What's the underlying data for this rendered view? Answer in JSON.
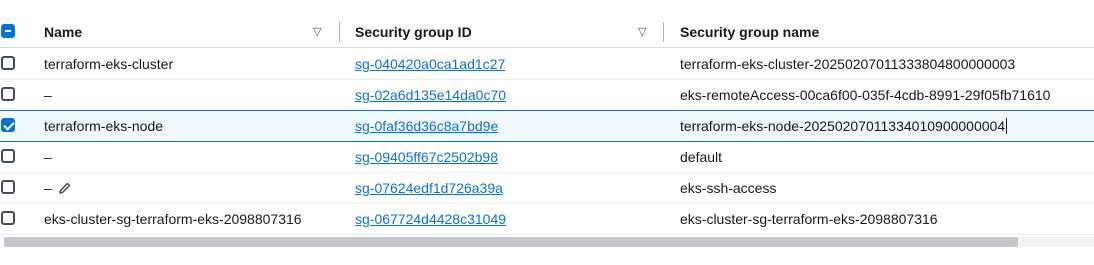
{
  "columns": {
    "name": "Name",
    "sg_id": "Security group ID",
    "sg_name": "Security group name",
    "sort_icon": "▽"
  },
  "rows": [
    {
      "name": "terraform-eks-cluster",
      "sg_id": "sg-040420a0ca1ad1c27",
      "sg_name": "terraform-eks-cluster-20250207011333804800000003",
      "checked": false
    },
    {
      "name": "–",
      "sg_id": "sg-02a6d135e14da0c70",
      "sg_name": "eks-remoteAccess-00ca6f00-035f-4cdb-8991-29f05fb71610",
      "checked": false
    },
    {
      "name": "terraform-eks-node",
      "sg_id": "sg-0faf36d36c8a7bd9e",
      "sg_name": "terraform-eks-node-20250207011334010900000004",
      "checked": true
    },
    {
      "name": "–",
      "sg_id": "sg-09405ff67c2502b98",
      "sg_name": "default",
      "checked": false
    },
    {
      "name": "–",
      "sg_id": "sg-07624edf1d726a39a",
      "sg_name": "eks-ssh-access",
      "checked": false
    },
    {
      "name": "eks-cluster-sg-terraform-eks-2098807316",
      "sg_id": "sg-067724d4428c31049",
      "sg_name": "eks-cluster-sg-terraform-eks-2098807316",
      "checked": false
    }
  ],
  "colors": {
    "accent": "#0972d3",
    "selected_bg": "#f1faff"
  }
}
